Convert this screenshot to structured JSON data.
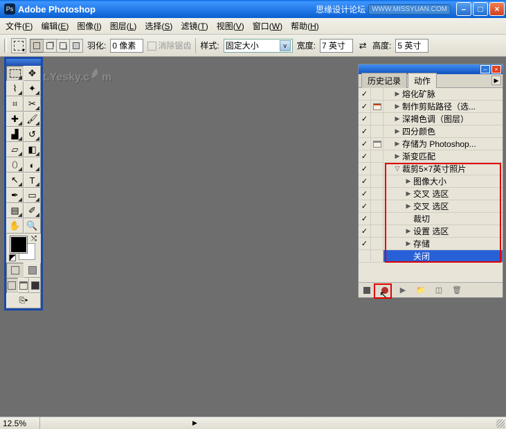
{
  "titlebar": {
    "app_name": "Adobe Photoshop",
    "forum": "思缘设计论坛",
    "url": "WWW.MISSYUAN.COM"
  },
  "menus": [
    {
      "label": "文件",
      "key": "F"
    },
    {
      "label": "编辑",
      "key": "E"
    },
    {
      "label": "图像",
      "key": "I"
    },
    {
      "label": "图层",
      "key": "L"
    },
    {
      "label": "选择",
      "key": "S"
    },
    {
      "label": "滤镜",
      "key": "T"
    },
    {
      "label": "视图",
      "key": "V"
    },
    {
      "label": "窗口",
      "key": "W"
    },
    {
      "label": "帮助",
      "key": "H"
    }
  ],
  "optbar": {
    "feather_label": "羽化:",
    "feather_value": "0 像素",
    "antialias": "消除锯齿",
    "style_label": "样式:",
    "style_value": "固定大小",
    "width_label": "宽度:",
    "width_value": "7 英寸",
    "height_label": "高度:",
    "height_value": "5 英寸"
  },
  "watermark_text": "Soft.Yesky.c   m",
  "panel": {
    "tab_history": "历史记录",
    "tab_actions": "动作"
  },
  "actions": [
    {
      "chk": true,
      "dlg": "none",
      "indent": 1,
      "tri": "▶",
      "label": "熔化矿脉"
    },
    {
      "chk": true,
      "dlg": "red",
      "indent": 1,
      "tri": "▶",
      "label": "制作剪贴路径（选..."
    },
    {
      "chk": true,
      "dlg": "none",
      "indent": 1,
      "tri": "▶",
      "label": "深褐色调（图层）"
    },
    {
      "chk": true,
      "dlg": "none",
      "indent": 1,
      "tri": "▶",
      "label": "四分颜色"
    },
    {
      "chk": true,
      "dlg": "gray",
      "indent": 1,
      "tri": "▶",
      "label": "存储为 Photoshop..."
    },
    {
      "chk": true,
      "dlg": "none",
      "indent": 1,
      "tri": "▶",
      "label": "渐变匹配"
    },
    {
      "chk": true,
      "dlg": "none",
      "indent": 1,
      "tri": "▽",
      "label": "裁剪5×7英寸照片",
      "red": true
    },
    {
      "chk": true,
      "dlg": "none",
      "indent": 2,
      "tri": "▶",
      "label": "图像大小",
      "red": true
    },
    {
      "chk": true,
      "dlg": "none",
      "indent": 2,
      "tri": "▶",
      "label": "交叉 选区",
      "red": true
    },
    {
      "chk": true,
      "dlg": "none",
      "indent": 2,
      "tri": "▶",
      "label": "交叉 选区",
      "red": true
    },
    {
      "chk": true,
      "dlg": "none",
      "indent": 2,
      "tri": "",
      "label": "裁切",
      "red": true
    },
    {
      "chk": true,
      "dlg": "none",
      "indent": 2,
      "tri": "▶",
      "label": "设置 选区",
      "red": true
    },
    {
      "chk": true,
      "dlg": "none",
      "indent": 2,
      "tri": "▶",
      "label": "存储",
      "red": true
    },
    {
      "chk": false,
      "dlg": "none",
      "indent": 2,
      "tri": "",
      "label": "关闭",
      "red": true,
      "sel": true
    }
  ],
  "status": {
    "zoom": "12.5%"
  }
}
